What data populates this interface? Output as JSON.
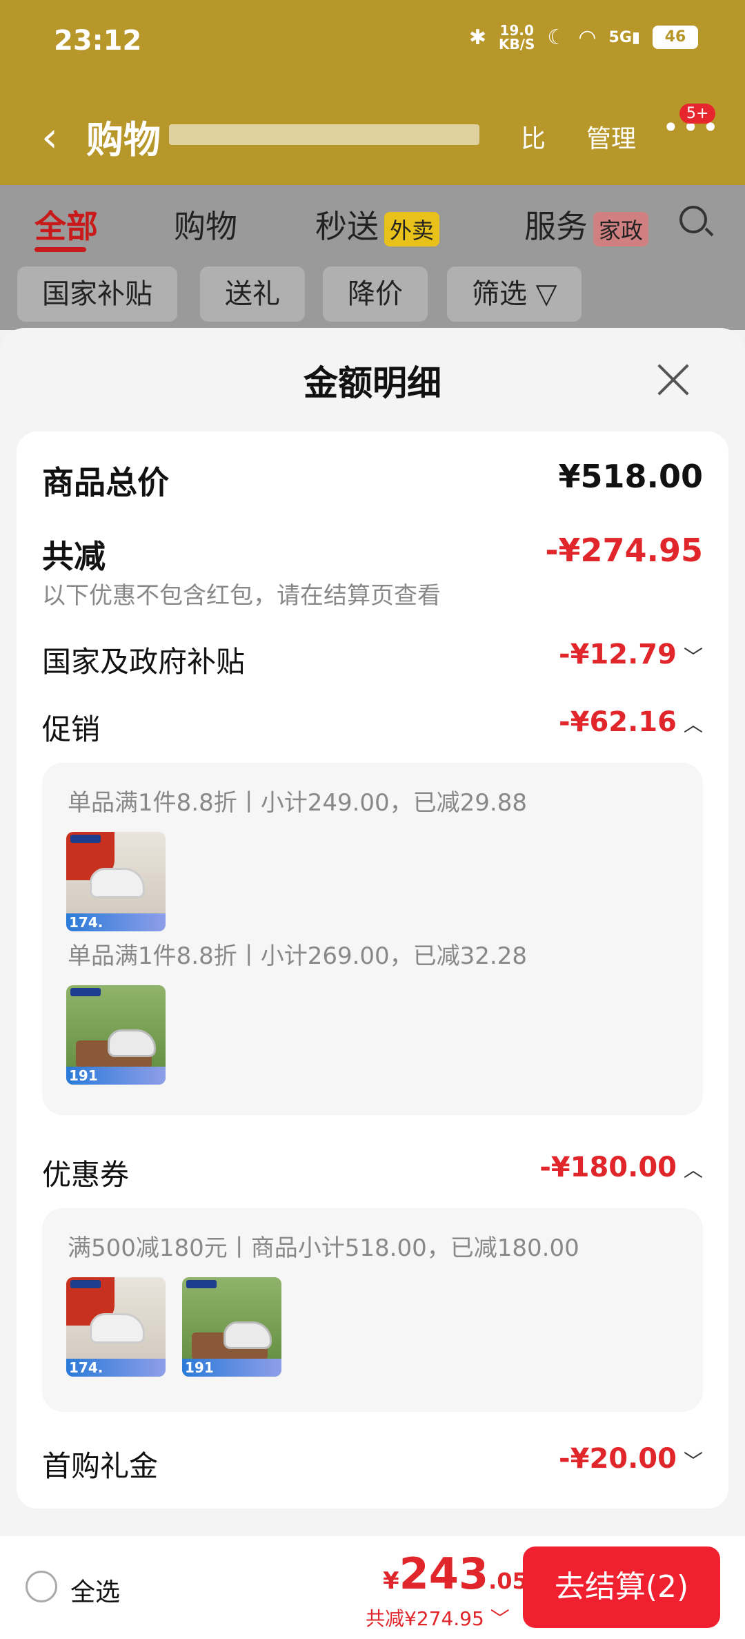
{
  "status": {
    "time": "23:12",
    "net_speed": "19.0",
    "net_unit": "KB/S",
    "signal": "5G",
    "battery": "46"
  },
  "nav": {
    "title": "购物",
    "compare": "比",
    "manage": "管理",
    "badge": "5+"
  },
  "tabs": [
    {
      "label": "全部"
    },
    {
      "label": "购物"
    },
    {
      "label": "秒送",
      "tag": "外卖"
    },
    {
      "label": "服务",
      "tag": "家政"
    }
  ],
  "chips": [
    "国家补贴",
    "送礼",
    "降价",
    "筛选"
  ],
  "sheet": {
    "title": "金额明细",
    "total_label": "商品总价",
    "total_value": "¥518.00",
    "reduce_label": "共减",
    "reduce_value": "-¥274.95",
    "note": "以下优惠不包含红包，请在结算页查看",
    "subsidy_label": "国家及政府补贴",
    "subsidy_value": "-¥12.79",
    "promo_label": "促销",
    "promo_value": "-¥62.16",
    "promo_items": [
      {
        "text": "单品满1件8.8折丨小计249.00，已减29.88",
        "price_tag": "174."
      },
      {
        "text": "单品满1件8.8折丨小计269.00，已减32.28",
        "price_tag": "191"
      }
    ],
    "coupon_label": "优惠券",
    "coupon_value": "-¥180.00",
    "coupon_text": "满500减180元丨商品小计518.00，已减180.00",
    "coupon_tags": [
      "174.",
      "191"
    ],
    "gift_label": "首购礼金",
    "gift_value": "-¥20.00"
  },
  "bottom": {
    "select_all": "全选",
    "currency": "¥",
    "amount_int": "243",
    "amount_dec": ".05",
    "saved": "共减¥274.95",
    "checkout": "去结算(2)"
  }
}
